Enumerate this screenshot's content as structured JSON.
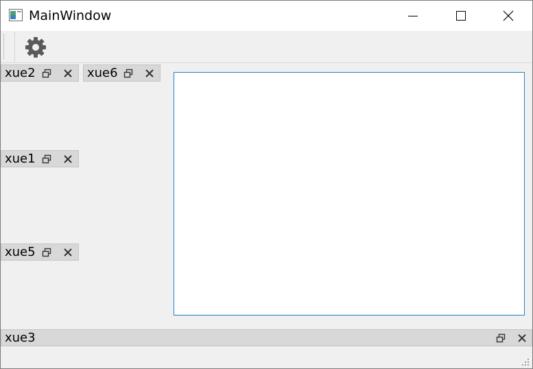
{
  "window": {
    "title": "MainWindow",
    "controls": [
      "minimize",
      "maximize",
      "close"
    ]
  },
  "toolbar": {
    "items": [
      {
        "icon": "gear-icon"
      }
    ]
  },
  "docks": {
    "xue2": {
      "label": "xue2"
    },
    "xue6": {
      "label": "xue6"
    },
    "xue1": {
      "label": "xue1"
    },
    "xue5": {
      "label": "xue5"
    },
    "xue3": {
      "label": "xue3"
    }
  },
  "colors": {
    "background": "#f0f0f0",
    "dock_titlebar": "#d8d8d8",
    "central_border": "#1f80c9",
    "icon_gray": "#5a5a5a"
  }
}
